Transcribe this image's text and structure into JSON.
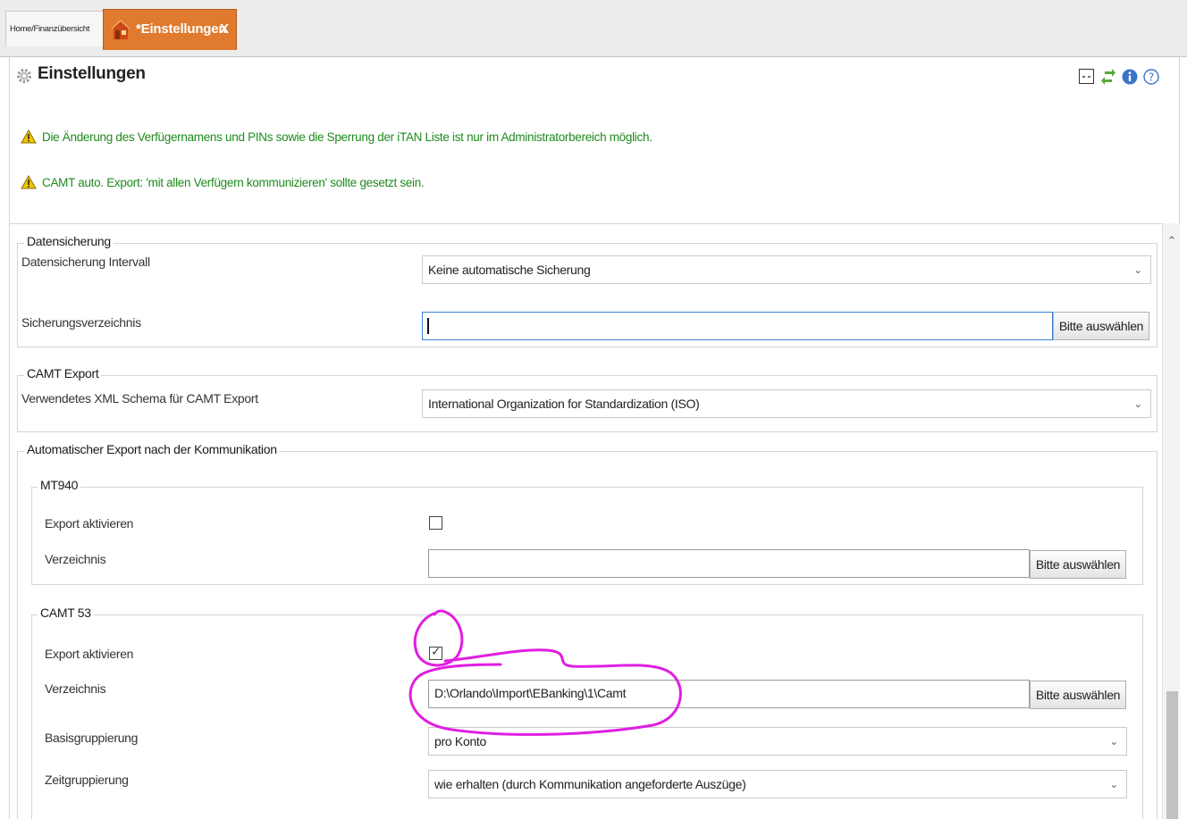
{
  "tabs": {
    "inactive_label": "Home/Finanzübersicht",
    "active_label": "*Einstellungen",
    "close_glyph": "X"
  },
  "header": {
    "title": "Einstellungen",
    "icons": [
      "collapse-icon",
      "refresh-icon",
      "info-icon",
      "help-icon"
    ]
  },
  "warnings": [
    "Die Änderung des Verfügernamens und PINs sowie die Sperrung der iTAN Liste ist nur im Administratorbereich möglich.",
    "CAMT auto. Export: 'mit allen Verfügern kommunizieren' sollte gesetzt sein."
  ],
  "datensicherung": {
    "legend": "Datensicherung",
    "interval_label": "Datensicherung Intervall",
    "interval_value": "Keine automatische Sicherung",
    "dir_label": "Sicherungsverzeichnis",
    "dir_value": "",
    "browse_label": "Bitte auswählen"
  },
  "camt_export": {
    "legend": "CAMT Export",
    "schema_label": "Verwendetes XML Schema für CAMT Export",
    "schema_value": "International Organization for Standardization (ISO)"
  },
  "auto_export": {
    "legend": "Automatischer Export nach der Kommunikation",
    "mt940": {
      "legend": "MT940",
      "enable_label": "Export aktivieren",
      "enabled": false,
      "dir_label": "Verzeichnis",
      "dir_value": "",
      "browse_label": "Bitte auswählen"
    },
    "camt53": {
      "legend": "CAMT 53",
      "enable_label": "Export aktivieren",
      "enabled": true,
      "dir_label": "Verzeichnis",
      "dir_value": "D:\\Orlando\\Import\\EBanking\\1\\Camt",
      "browse_label": "Bitte auswählen",
      "base_group_label": "Basisgruppierung",
      "base_group_value": "pro Konto",
      "time_group_label": "Zeitgruppierung",
      "time_group_value": "wie erhalten (durch Kommunikation angeforderte Auszüge)"
    }
  },
  "colors": {
    "tab_active": "#e07a2e",
    "warning_text": "#1e8a1e",
    "annotation": "#e01ee0"
  }
}
